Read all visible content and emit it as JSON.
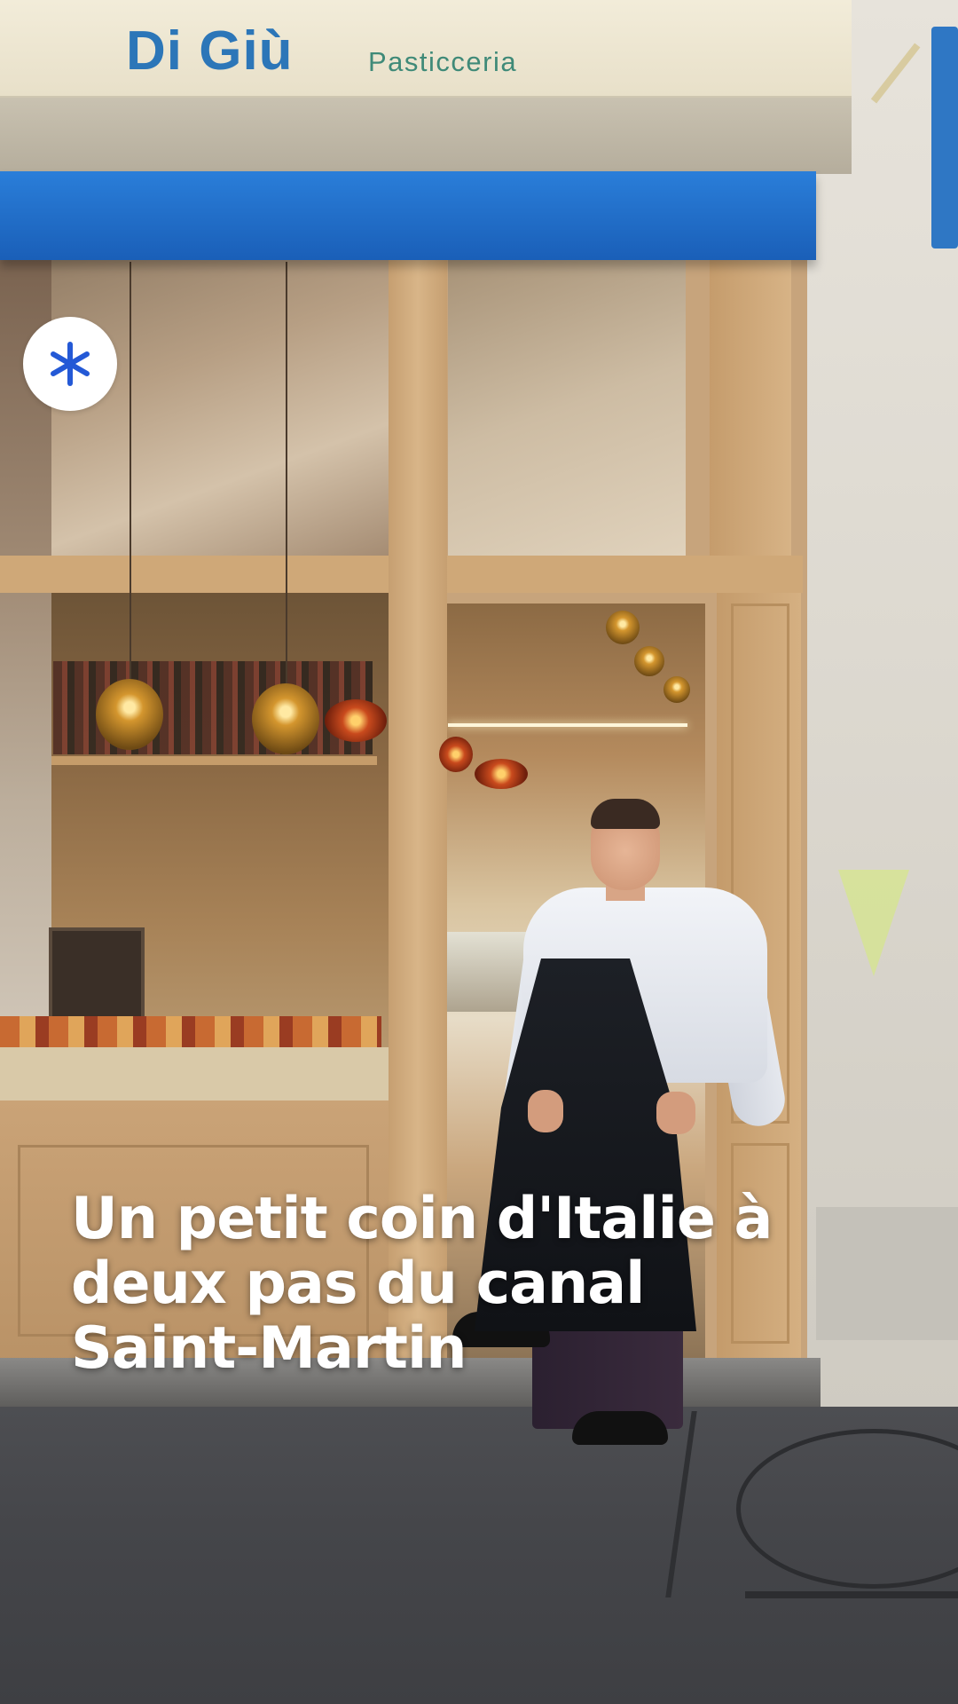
{
  "storefront": {
    "brand_name": "Di Giù",
    "brand_subtitle": "Pasticceria"
  },
  "overlay": {
    "logo_icon": "asterisk-icon",
    "logo_color": "#2459d6",
    "caption": "Un petit coin d'Italie à\ndeux pas du canal\nSaint-Martin"
  }
}
